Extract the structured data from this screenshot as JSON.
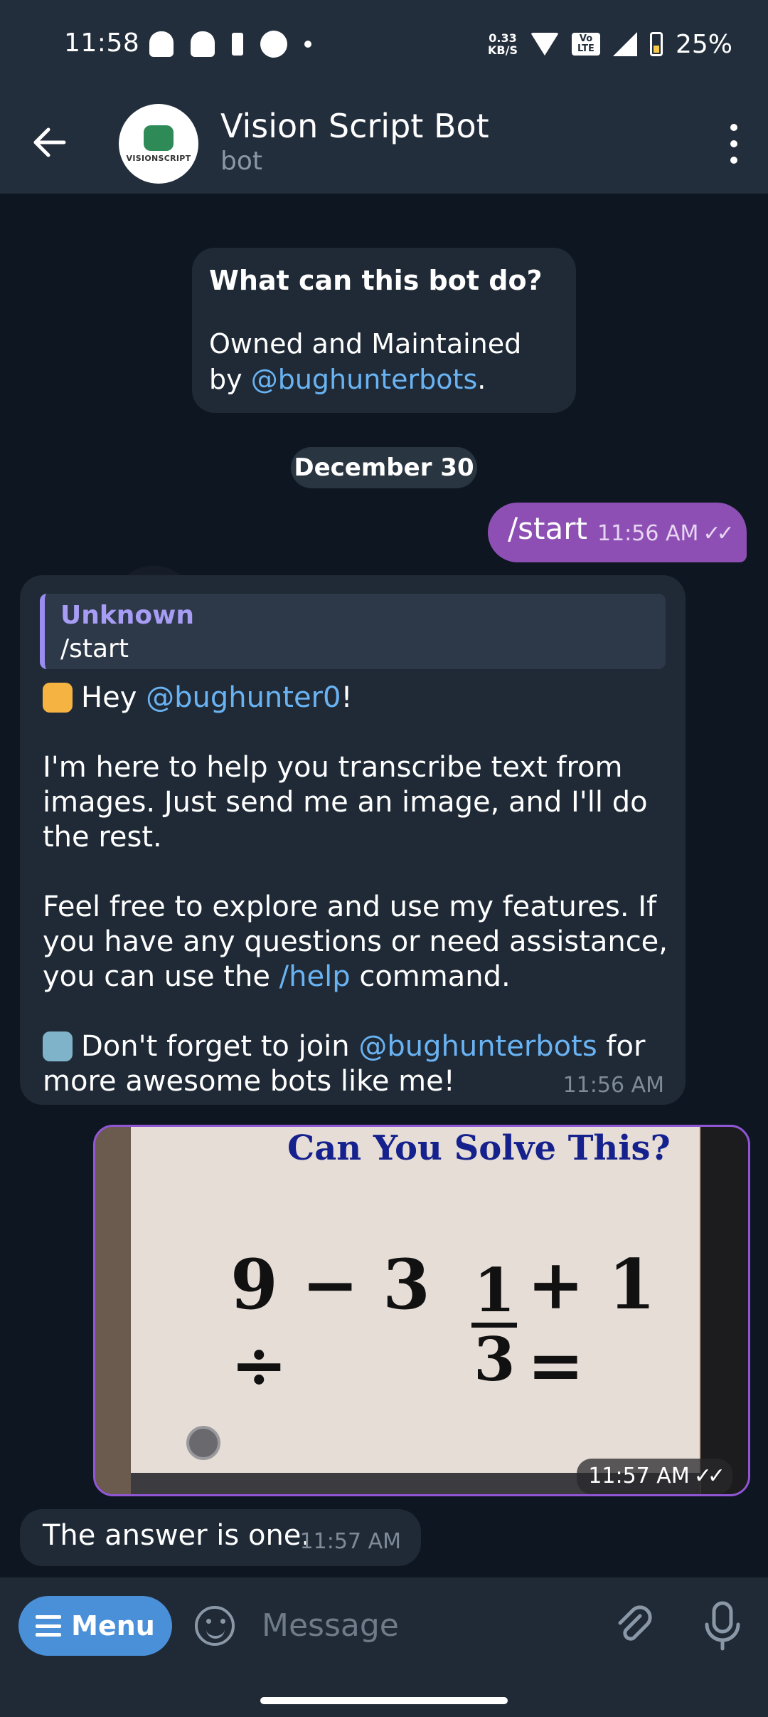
{
  "status_bar": {
    "time": "11:58",
    "net_speed": "0.33",
    "net_unit": "KB/S",
    "volte": "Vo LTE",
    "battery": "25%"
  },
  "header": {
    "title": "Vision Script Bot",
    "subtitle": "bot",
    "avatar_text": "VISIONSCRIPT"
  },
  "bot_info": {
    "title": "What can this bot do?",
    "body": "Owned and Maintained by",
    "link": "@bughunterbots",
    "suffix": "."
  },
  "date_separator": "December 30",
  "messages": {
    "start": {
      "text": "/start",
      "time": "11:56 AM"
    },
    "welcome": {
      "reply_name": "Unknown",
      "reply_text": "/start",
      "hey": "Hey",
      "mention": "@bughunter0",
      "exclam": "!",
      "para1": "I'm here to help you transcribe text from images. Just send me an image, and I'll do the rest.",
      "para2_a": "Feel free to explore and use my features. If you have any questions or need assistance, you can use the",
      "para2_link": "/help",
      "para2_b": "command.",
      "para3_a": "Don't forget to join",
      "para3_link": "@bughunterbots",
      "para3_b": "for more awesome bots like me!",
      "time": "11:56 AM"
    },
    "photo": {
      "title": "Can You Solve This?",
      "eq_left": "9 − 3 ÷",
      "num": "1",
      "den": "3",
      "eq_right": "+ 1 =",
      "time": "11:57 AM"
    },
    "answer": {
      "text": "The answer is one.",
      "time": "11:57 AM"
    }
  },
  "input_bar": {
    "menu_label": "Menu",
    "placeholder": "Message"
  }
}
